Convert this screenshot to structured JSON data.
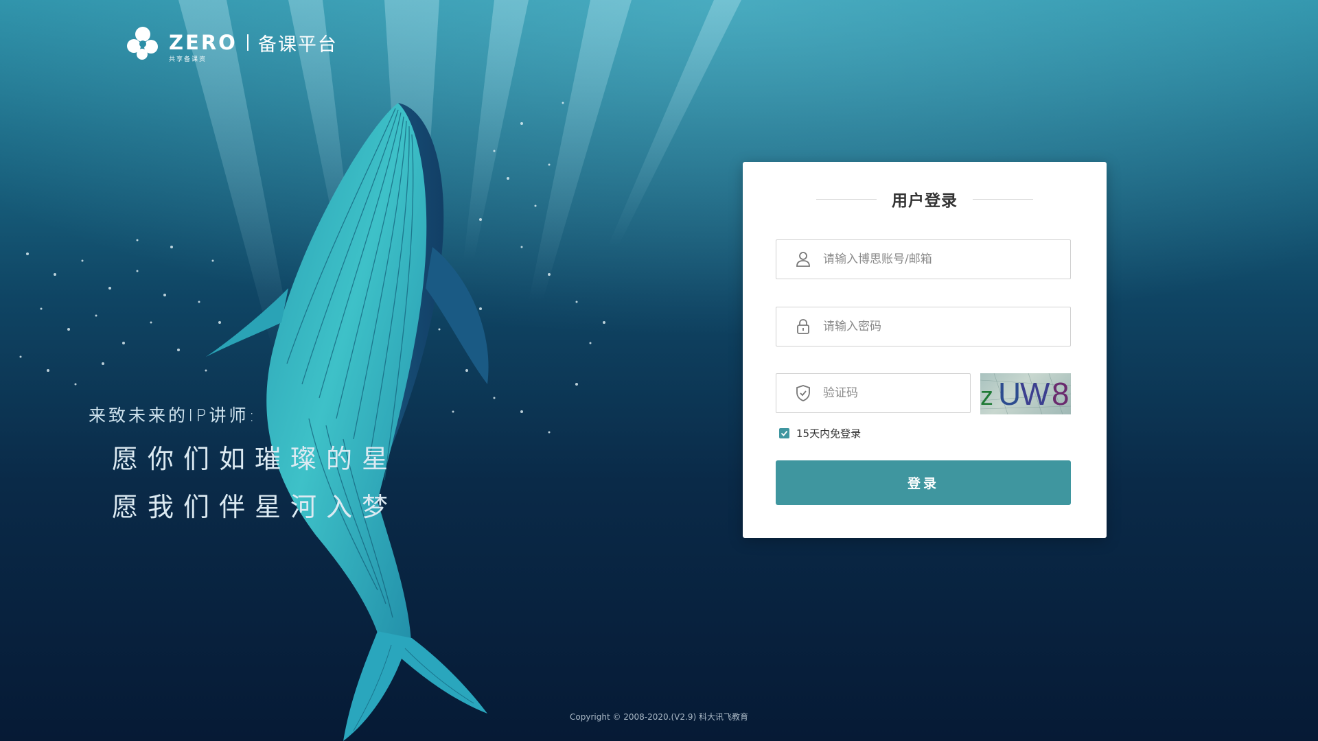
{
  "brand": {
    "logo_word": "ZERO",
    "logo_tagline": "共享备课资",
    "title": "备课平台"
  },
  "slogan": {
    "sub": "来致未来的IP讲师:",
    "line1": "愿你们如璀璨的星",
    "line2": "愿我们伴星河入梦"
  },
  "login": {
    "title": "用户登录",
    "username": {
      "placeholder": "请输入博思账号/邮箱",
      "value": ""
    },
    "password": {
      "placeholder": "请输入密码",
      "value": ""
    },
    "captcha": {
      "placeholder": "验证码",
      "value": "",
      "image_text": "zUW8"
    },
    "remember_label": "15天内免登录",
    "remember_checked": true,
    "submit_label": "登录"
  },
  "footer": {
    "copyright": "Copyright © 2008-2020.(V2.9) 科大讯飞教育"
  },
  "colors": {
    "accent": "#3f969f",
    "card_bg": "#ffffff",
    "background_top": "#2a8ea6",
    "background_bottom": "#061a35"
  }
}
